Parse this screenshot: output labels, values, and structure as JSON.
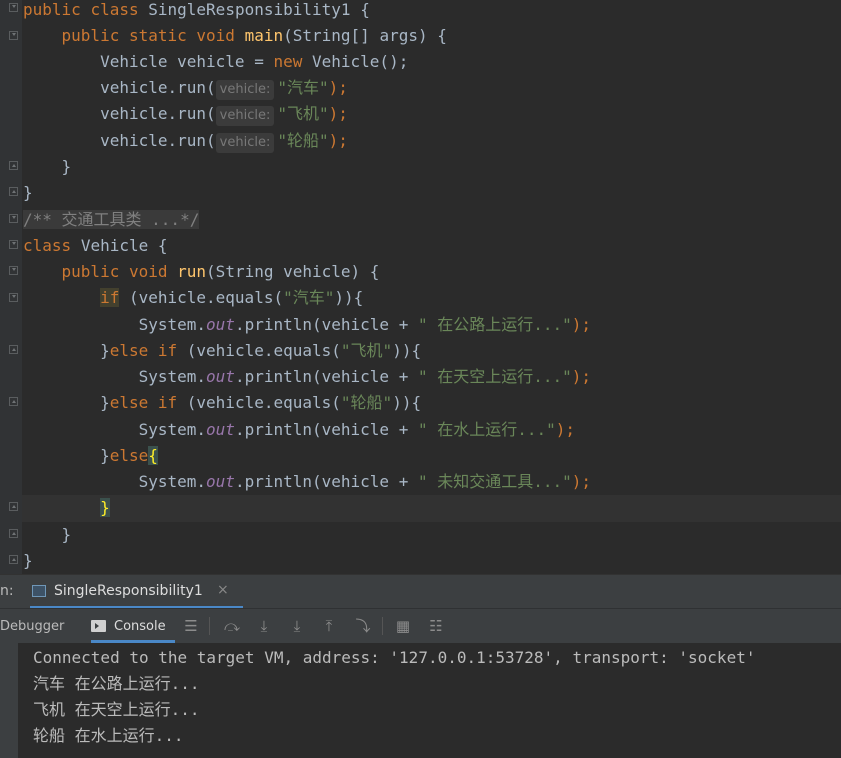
{
  "editor": {
    "class_name": "SingleResponsibility1",
    "main_sig_name": "main",
    "main_sig_params": "(String[] args) {",
    "vehicle_decl": "Vehicle vehicle = ",
    "vehicle_ctor": "Vehicle();",
    "call_prefix": "vehicle.run(",
    "param_hint": "vehicle:",
    "arg_car": "\"汽车\"",
    "arg_plane": "\"飞机\"",
    "arg_ship": "\"轮船\"",
    "call_suffix": ");",
    "collapsed_comment": "/** 交通工具类 ...*/",
    "class2_name": "Vehicle {",
    "run_name": "run",
    "run_params": "(String vehicle) {",
    "equals_open": " (vehicle.equals(",
    "equals_close": ")){",
    "println_prefix": "System.",
    "println_field": "out",
    "println_mid": ".println(vehicle + ",
    "msg_road": "\" 在公路上运行...\"",
    "msg_sky": "\" 在天空上运行...\"",
    "msg_water": "\" 在水上运行...\"",
    "msg_unknown": "\" 未知交通工具...\"",
    "println_end": ");",
    "kw": {
      "public": "public",
      "class": "class",
      "static": "static",
      "void": "void",
      "new": "new",
      "if": "if",
      "else": "else"
    },
    "brace_open": "{",
    "brace_close": "}",
    "else_brace": "}"
  },
  "run_panel": {
    "label": "n:",
    "tab_name": "SingleResponsibility1",
    "tab_close": "×",
    "debugger_tab": "Debugger",
    "console_tab": "Console"
  },
  "console": {
    "lines": [
      "Connected to the target VM, address: '127.0.0.1:53728', transport: 'socket'",
      "汽车 在公路上运行...",
      "飞机 在天空上运行...",
      "轮船 在水上运行..."
    ]
  }
}
